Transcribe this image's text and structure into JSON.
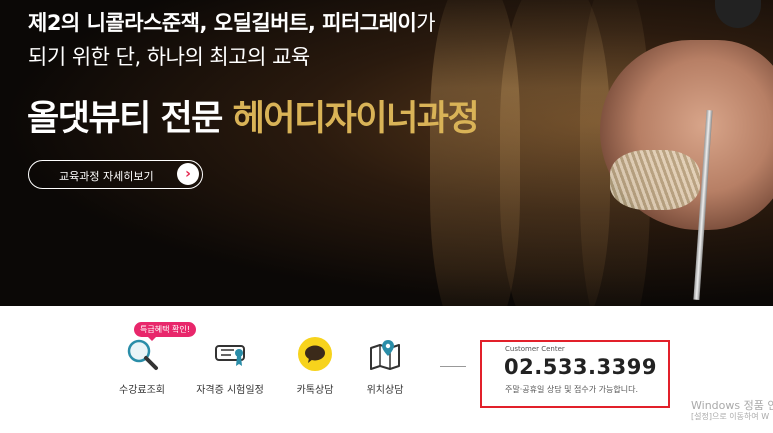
{
  "hero": {
    "line1_bold": "제2의 니콜라스준잭, 오딜길버트, 피터그레이",
    "line1_tail": "가",
    "line2": "되기 위한 단, 하나의 최고의 교육",
    "title_white": "올댓뷰티 전문 ",
    "title_gold": "헤어디자이너과정",
    "cta_label": "교육과정 자세히보기",
    "cta_arrow": "›",
    "accent": "#d9b357"
  },
  "quick_menu": {
    "badge": "특급혜택 확인!",
    "items": [
      {
        "label": "수강료조회",
        "icon": "magnifier-icon"
      },
      {
        "label": "자격증 시험일정",
        "icon": "certificate-icon"
      },
      {
        "label": "카톡상담",
        "icon": "kakaotalk-icon"
      },
      {
        "label": "위치상담",
        "icon": "map-pin-icon"
      }
    ]
  },
  "customer_center": {
    "title": "Customer Center",
    "phone": "02.533.3399",
    "note": "주말·공휴일 상담 및 접수가 가능합니다.",
    "border_color": "#e2202a"
  },
  "watermark": {
    "line1": "Windows 정품 인",
    "line2": "[설정]으로 이동하여 W"
  }
}
